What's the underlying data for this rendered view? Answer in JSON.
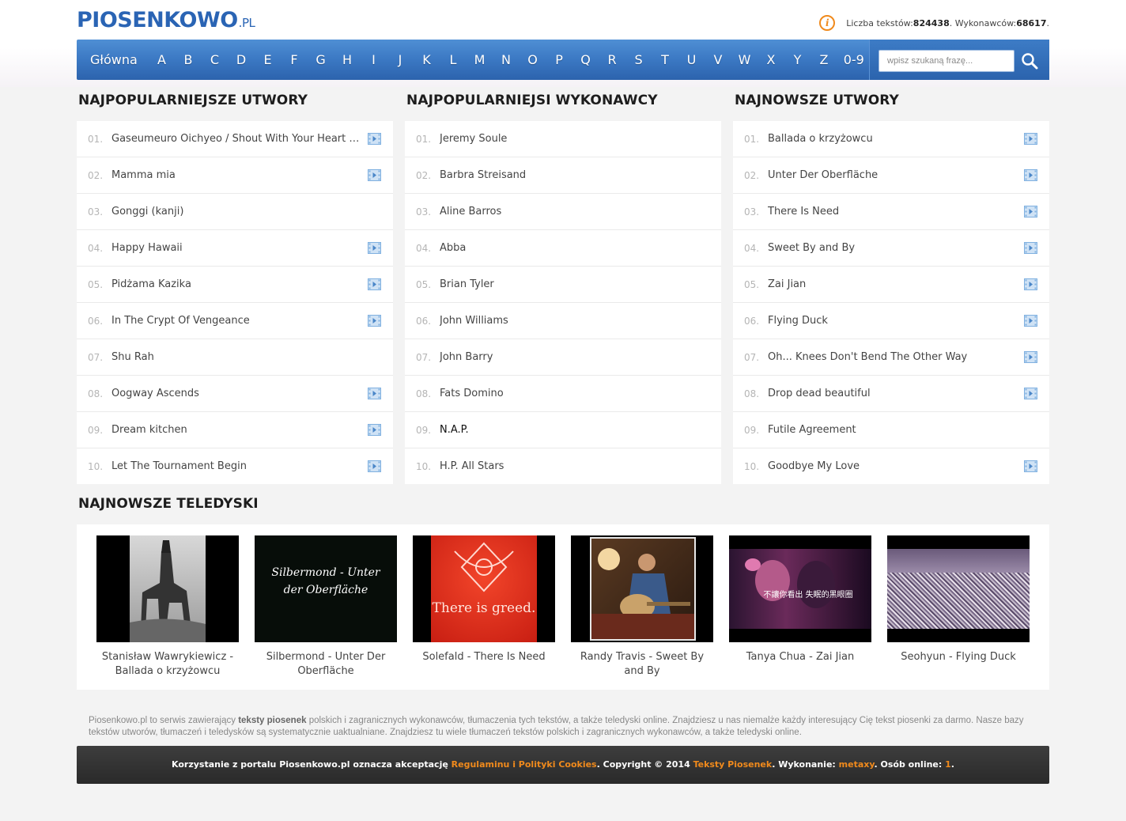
{
  "header": {
    "logo_main": "PIOSENKOWO",
    "logo_tld": ".PL",
    "stats_label_songs": "Liczba tekstów: ",
    "stats_songs": "824438",
    "stats_label_artists": ". Wykonawców: ",
    "stats_artists": "68617",
    "stats_end": "."
  },
  "nav": {
    "home": "Główna",
    "letters": [
      "A",
      "B",
      "C",
      "D",
      "E",
      "F",
      "G",
      "H",
      "I",
      "J",
      "K",
      "L",
      "M",
      "N",
      "O",
      "P",
      "Q",
      "R",
      "S",
      "T",
      "U",
      "V",
      "W",
      "X",
      "Y",
      "Z"
    ],
    "digits": "0-9",
    "search_placeholder": "wpisz szukaną frazę..."
  },
  "popular_songs": {
    "title": "NAJPOPULARNIEJSZE UTWORY",
    "items": [
      {
        "num": "01.",
        "title": "Gaseumeuro Oichyeo / Shout With Your Heart Feat...",
        "video": true
      },
      {
        "num": "02.",
        "title": "Mamma mia",
        "video": true
      },
      {
        "num": "03.",
        "title": "Gonggi (kanji)",
        "video": false
      },
      {
        "num": "04.",
        "title": "Happy Hawaii",
        "video": true
      },
      {
        "num": "05.",
        "title": "Pidżama Kazika",
        "video": true
      },
      {
        "num": "06.",
        "title": "In The Crypt Of Vengeance",
        "video": true
      },
      {
        "num": "07.",
        "title": "Shu Rah",
        "video": false
      },
      {
        "num": "08.",
        "title": "Oogway Ascends",
        "video": true
      },
      {
        "num": "09.",
        "title": "Dream kitchen",
        "video": true
      },
      {
        "num": "10.",
        "title": "Let The Tournament Begin",
        "video": true
      }
    ]
  },
  "popular_artists": {
    "title": "NAJPOPULARNIEJSI WYKONAWCY",
    "items": [
      {
        "num": "01.",
        "title": "Jeremy Soule"
      },
      {
        "num": "02.",
        "title": "Barbra Streisand"
      },
      {
        "num": "03.",
        "title": "Aline Barros"
      },
      {
        "num": "04.",
        "title": "Abba"
      },
      {
        "num": "05.",
        "title": "Brian Tyler"
      },
      {
        "num": "06.",
        "title": "John Williams"
      },
      {
        "num": "07.",
        "title": "John Barry"
      },
      {
        "num": "08.",
        "title": "Fats Domino"
      },
      {
        "num": "09.",
        "title": "N.A.P."
      },
      {
        "num": "10.",
        "title": "H.P. All Stars"
      }
    ]
  },
  "newest_songs": {
    "title": "NAJNOWSZE UTWORY",
    "items": [
      {
        "num": "01.",
        "title": "Ballada o krzyżowcu",
        "video": true
      },
      {
        "num": "02.",
        "title": "Unter Der Oberfläche",
        "video": true
      },
      {
        "num": "03.",
        "title": "There Is Need",
        "video": true
      },
      {
        "num": "04.",
        "title": "Sweet By and By",
        "video": true
      },
      {
        "num": "05.",
        "title": "Zai Jian",
        "video": true
      },
      {
        "num": "06.",
        "title": "Flying Duck",
        "video": true
      },
      {
        "num": "07.",
        "title": "Oh... Knees Don't Bend The Other Way",
        "video": true
      },
      {
        "num": "08.",
        "title": "Drop dead beautiful",
        "video": true
      },
      {
        "num": "09.",
        "title": "Futile Agreement",
        "video": false
      },
      {
        "num": "10.",
        "title": "Goodbye My Love",
        "video": true
      }
    ]
  },
  "newest_videos": {
    "title": "NAJNOWSZE TELEDYSKI",
    "items": [
      {
        "caption": "Stanisław Wawrykiewicz - Ballada o krzyżowcu"
      },
      {
        "caption": "Silbermond - Unter Der Oberfläche",
        "thumb_text": "Silbermond - Unter der Oberfläche"
      },
      {
        "caption": "Solefald - There Is Need",
        "thumb_text": "There is greed."
      },
      {
        "caption": "Randy Travis - Sweet By and By"
      },
      {
        "caption": "Tanya Chua - Zai Jian",
        "thumb_text": "不讓你看出 失眠的黑眼圈"
      },
      {
        "caption": "Seohyun - Flying Duck"
      }
    ]
  },
  "footer": {
    "text_1": "Piosenkowo.pl to serwis zawierający ",
    "text_bold": "teksty piosenek",
    "text_2": " polskich i zagranicznych wykonawców, tłumaczenia tych tekstów, a także teledyski online. Znajdziesz u nas niemalże każdy interesujący Cię tekst piosenki za darmo. Nasze bazy tekstów utworów, tłumaczeń i teledysków są systematycznie uaktualniane. Znajdziesz tu wiele tłumaczeń tekstów polskich i zagranicznych wykonawców, a także teledyski online.",
    "bar_1": "Korzystanie z portalu Piosenkowo.pl oznacza akceptację ",
    "bar_link_rules": "Regulaminu i Polityki Cookies",
    "bar_2": ". Copyright © 2014 ",
    "bar_link_texts": "Teksty Piosenek",
    "bar_3": ". Wykonanie: ",
    "bar_link_author": "metaxy",
    "bar_4": ". Osób online: ",
    "bar_online": "1",
    "bar_5": "."
  },
  "colors": {
    "brand_blue": "#2a64b4",
    "nav_blue": "#3b78c3",
    "accent_orange": "#f08a1c",
    "video_icon": "#7fb0e0"
  }
}
